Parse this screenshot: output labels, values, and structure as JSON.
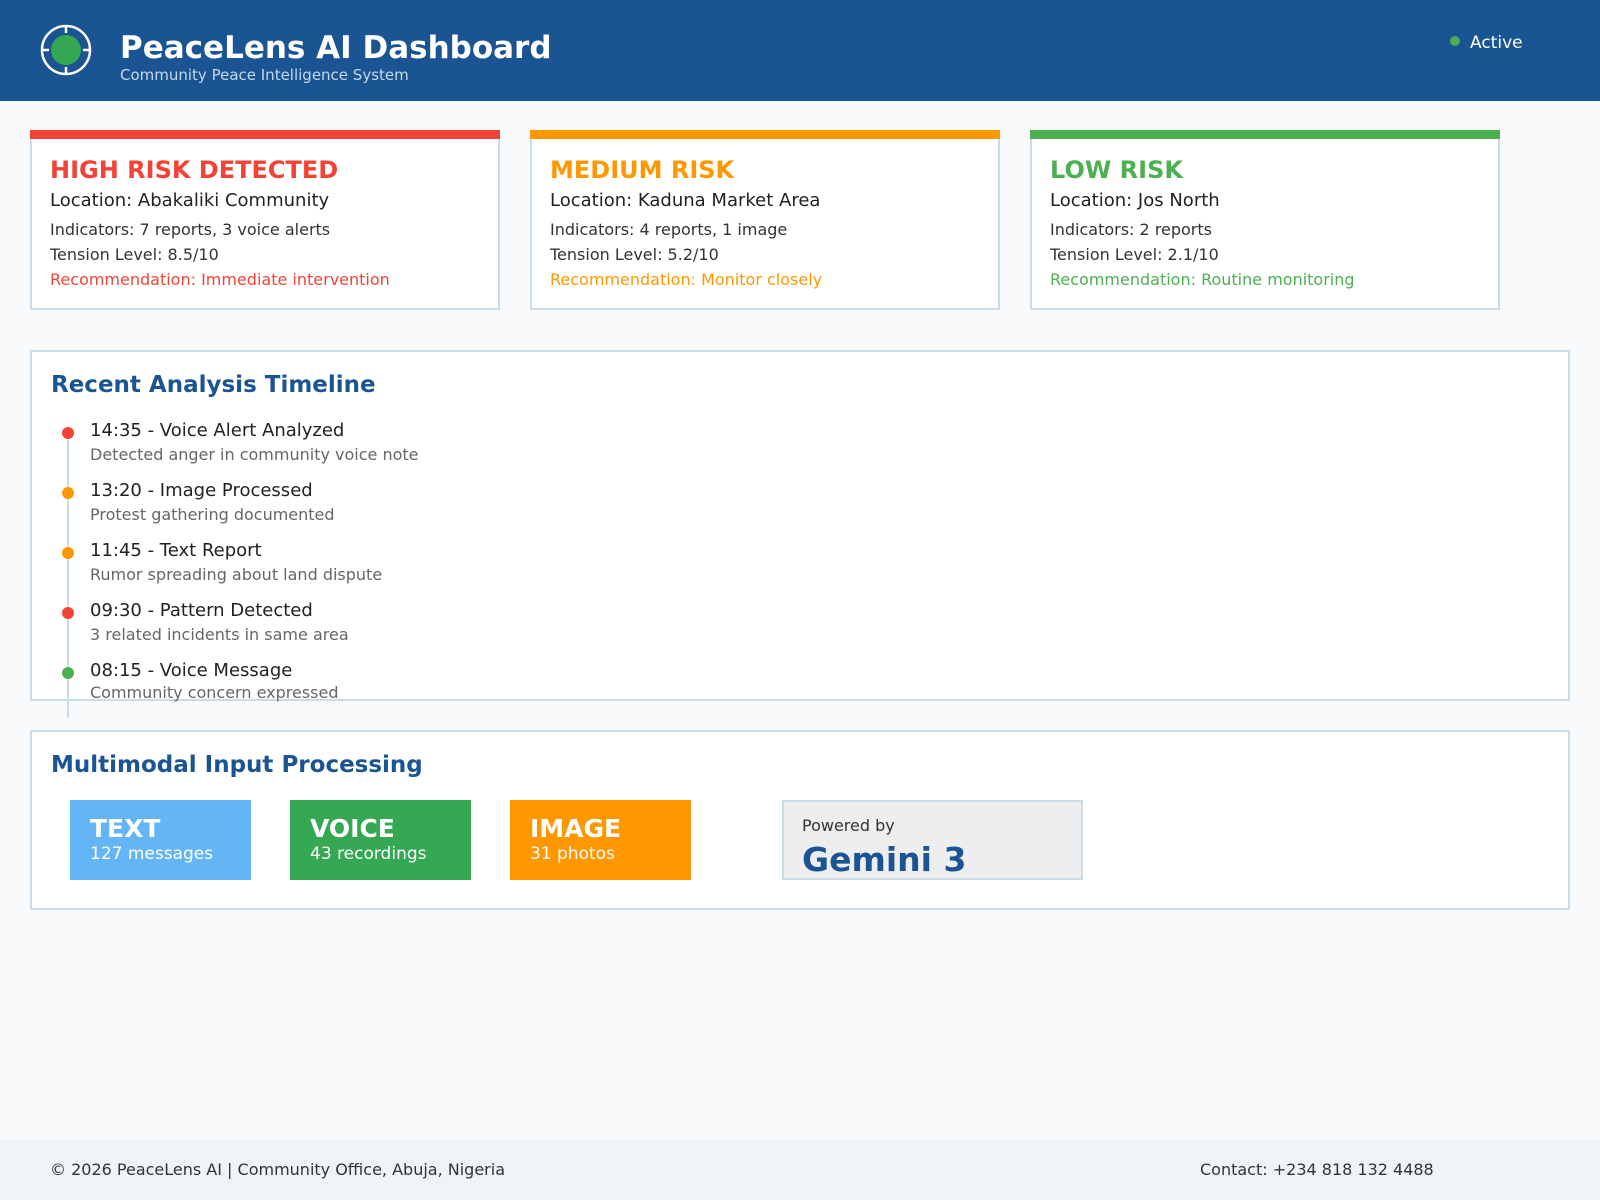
{
  "header": {
    "title": "PeaceLens AI Dashboard",
    "subtitle": "Community Peace Intelligence System",
    "status": "Active",
    "logo_icon": "globe-target-icon",
    "colors": {
      "background": "#1a5493",
      "status_dot": "#4caf50"
    }
  },
  "risk_cards": [
    {
      "title": "HIGH RISK DETECTED",
      "location": "Location: Abakaliki Community",
      "indicators": "Indicators: 7 reports, 3 voice alerts",
      "tension": "Tension Level: 8.5/10",
      "recommendation": "Recommendation: Immediate intervention",
      "color": "#f44336"
    },
    {
      "title": "MEDIUM RISK",
      "location": "Location: Kaduna Market Area",
      "indicators": "Indicators: 4 reports, 1 image",
      "tension": "Tension Level: 5.2/10",
      "recommendation": "Recommendation: Monitor closely",
      "color": "#ff9800"
    },
    {
      "title": "LOW RISK",
      "location": "Location: Jos North",
      "indicators": "Indicators: 2 reports",
      "tension": "Tension Level: 2.1/10",
      "recommendation": "Recommendation: Routine monitoring",
      "color": "#4caf50"
    }
  ],
  "timeline": {
    "title": "Recent Analysis Timeline",
    "items": [
      {
        "heading": "14:35 - Voice Alert Analyzed",
        "description": "Detected anger in community voice note",
        "color": "#f44336"
      },
      {
        "heading": "13:20 - Image Processed",
        "description": "Protest gathering documented",
        "color": "#ff9800"
      },
      {
        "heading": "11:45 - Text Report",
        "description": "Rumor spreading about land dispute",
        "color": "#ff9800"
      },
      {
        "heading": "09:30 - Pattern Detected",
        "description": "3 related incidents in same area",
        "color": "#f44336"
      },
      {
        "heading": "08:15 - Voice Message",
        "description": "Community concern expressed",
        "color": "#4caf50"
      }
    ]
  },
  "multimodal": {
    "title": "Multimodal Input Processing",
    "inputs": [
      {
        "label": "TEXT",
        "count": "127 messages",
        "color": "#64b5f6"
      },
      {
        "label": "VOICE",
        "count": "43 recordings",
        "color": "#34a853"
      },
      {
        "label": "IMAGE",
        "count": "31 photos",
        "color": "#ff9800"
      }
    ],
    "powered_by": "Powered by",
    "engine": "Gemini 3"
  },
  "footer": {
    "copyright": "© 2026 PeaceLens AI | Community Office, Abuja, Nigeria",
    "contact": "Contact: +234 818 132 4488"
  }
}
